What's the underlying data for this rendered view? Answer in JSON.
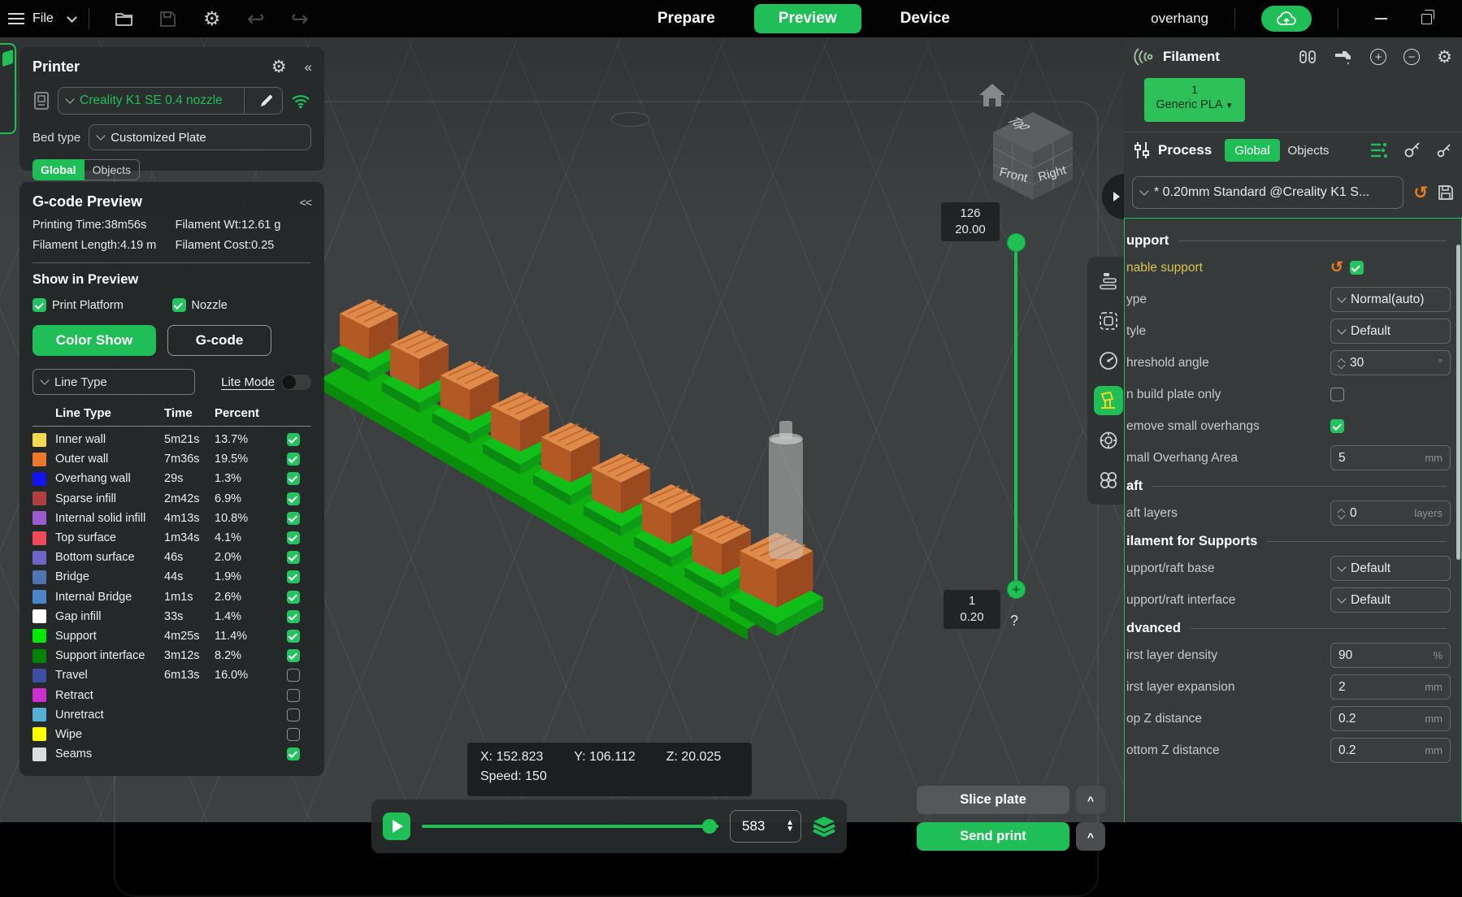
{
  "titlebar": {
    "file_menu": "File",
    "tabs": {
      "prepare": "Prepare",
      "preview": "Preview",
      "device": "Device"
    },
    "project_name": "overhang"
  },
  "icons": {
    "gear": "⚙",
    "undo": "↩",
    "redo": "↪",
    "reset": "↺",
    "collapse_left": "«",
    "collapse_arrows": "<<",
    "stepper_up": "▲",
    "stepper_down": "▼",
    "dropdown_arrow": "▼"
  },
  "printer_panel": {
    "title": "Printer",
    "printer_name": "Creality K1 SE 0.4 nozzle",
    "bed_type_label": "Bed type",
    "bed_type_value": "Customized Plate",
    "scope_tabs": {
      "global": "Global",
      "objects": "Objects"
    }
  },
  "gcode_panel": {
    "title": "G-code Preview",
    "stats": [
      {
        "label": "Printing Time:",
        "value": "38m56s"
      },
      {
        "label": "Filament Wt:",
        "value": "12.61 g"
      },
      {
        "label": "Filament Length:",
        "value": "4.19 m"
      },
      {
        "label": "Filament Cost:",
        "value": "0.25"
      }
    ],
    "show_in_preview": {
      "title": "Show in Preview",
      "options": [
        {
          "label": "Print Platform",
          "checked": true
        },
        {
          "label": "Nozzle",
          "checked": true
        }
      ]
    },
    "view_mode": {
      "color_show": "Color Show",
      "gcode": "G-code"
    },
    "filter": {
      "line_type": "Line Type",
      "lite_mode": "Lite Mode",
      "lite_mode_on": false
    },
    "table": {
      "headers": [
        "Line Type",
        "Time",
        "Percent"
      ],
      "rows": [
        {
          "label": "Inner wall",
          "color": "#F5D94F",
          "time": "5m21s",
          "percent": "13.7%",
          "checked": true
        },
        {
          "label": "Outer wall",
          "color": "#F2772E",
          "time": "7m36s",
          "percent": "19.5%",
          "checked": true
        },
        {
          "label": "Overhang wall",
          "color": "#1414F0",
          "time": "29s",
          "percent": "1.3%",
          "checked": true
        },
        {
          "label": "Sparse infill",
          "color": "#B04040",
          "time": "2m42s",
          "percent": "6.9%",
          "checked": true
        },
        {
          "label": "Internal solid infill",
          "color": "#9C5BD1",
          "time": "4m13s",
          "percent": "10.8%",
          "checked": true
        },
        {
          "label": "Top surface",
          "color": "#EF4A5A",
          "time": "1m34s",
          "percent": "4.1%",
          "checked": true
        },
        {
          "label": "Bottom surface",
          "color": "#6F65C9",
          "time": "46s",
          "percent": "2.0%",
          "checked": true
        },
        {
          "label": "Bridge",
          "color": "#4F74B3",
          "time": "44s",
          "percent": "1.9%",
          "checked": true
        },
        {
          "label": "Internal Bridge",
          "color": "#4A86C9",
          "time": "1m1s",
          "percent": "2.6%",
          "checked": true
        },
        {
          "label": "Gap infill",
          "color": "#FFFFFF",
          "time": "33s",
          "percent": "1.4%",
          "checked": true
        },
        {
          "label": "Support",
          "color": "#00E700",
          "time": "4m25s",
          "percent": "11.4%",
          "checked": true
        },
        {
          "label": "Support interface",
          "color": "#068206",
          "time": "3m12s",
          "percent": "8.2%",
          "checked": true
        },
        {
          "label": "Travel",
          "color": "#3D4FA2",
          "time": "6m13s",
          "percent": "16.0%",
          "checked": false
        },
        {
          "label": "Retract",
          "color": "#CC2FD0",
          "time": "",
          "percent": "",
          "checked": false
        },
        {
          "label": "Unretract",
          "color": "#55AED6",
          "time": "",
          "percent": "",
          "checked": false
        },
        {
          "label": "Wipe",
          "color": "#FFFF00",
          "time": "",
          "percent": "",
          "checked": false
        },
        {
          "label": "Seams",
          "color": "#DCDCDC",
          "time": "",
          "percent": "",
          "checked": true
        }
      ]
    }
  },
  "viewport": {
    "cube_faces": {
      "top": "Top",
      "front": "Front",
      "right": "Right"
    },
    "layer_slider": {
      "top_layer": "126",
      "top_height": "20.00",
      "bottom_layer": "1",
      "bottom_height": "0.20",
      "help": "?"
    },
    "status_overlay": {
      "x": "X: 152.823",
      "y": "Y: 106.112",
      "z": "Z: 20.025",
      "speed": "Speed: 150"
    },
    "playback": {
      "step_value": "583"
    },
    "actions": {
      "slice": "Slice plate",
      "send": "Send print",
      "caret": "^"
    }
  },
  "right_panel": {
    "filament": {
      "title": "Filament",
      "slot_number": "1",
      "material": "Generic PLA"
    },
    "process": {
      "title": "Process",
      "tabs": {
        "global": "Global",
        "objects": "Objects"
      }
    },
    "preset_value": "* 0.20mm  Standard @Creality K1 S...",
    "sections": [
      {
        "title": "upport",
        "rows": [
          {
            "label": "nable support",
            "control": "checkbox",
            "checked": true,
            "modified": true
          },
          {
            "label": "ype",
            "control": "select",
            "value": "Normal(auto)"
          },
          {
            "label": "tyle",
            "control": "select",
            "value": "Default"
          },
          {
            "label": "hreshold angle",
            "control": "spinner",
            "value": "30",
            "unit": "°"
          },
          {
            "label": "n build plate only",
            "control": "checkbox",
            "checked": false
          },
          {
            "label": "emove small overhangs",
            "control": "checkbox",
            "checked": true
          },
          {
            "label": "mall Overhang Area",
            "control": "input",
            "value": "5",
            "unit": "mm"
          }
        ]
      },
      {
        "title": "aft",
        "rows": [
          {
            "label": "aft layers",
            "control": "spinner",
            "value": "0",
            "unit": "layers"
          }
        ]
      },
      {
        "title": "ilament for Supports",
        "rows": [
          {
            "label": "upport/raft base",
            "control": "select",
            "value": "Default"
          },
          {
            "label": "upport/raft interface",
            "control": "select",
            "value": "Default"
          }
        ]
      },
      {
        "title": "dvanced",
        "rows": [
          {
            "label": "irst layer density",
            "control": "input",
            "value": "90",
            "unit": "%"
          },
          {
            "label": "irst layer expansion",
            "control": "input",
            "value": "2",
            "unit": "mm"
          },
          {
            "label": "op Z distance",
            "control": "input",
            "value": "0.2",
            "unit": "mm"
          },
          {
            "label": "ottom Z distance",
            "control": "input",
            "value": "0.2",
            "unit": "mm"
          }
        ]
      }
    ]
  },
  "colors": {
    "accent_green": "#1fbe57",
    "modified_yellow": "#d8c34c",
    "reset_orange": "#e67c1e"
  }
}
